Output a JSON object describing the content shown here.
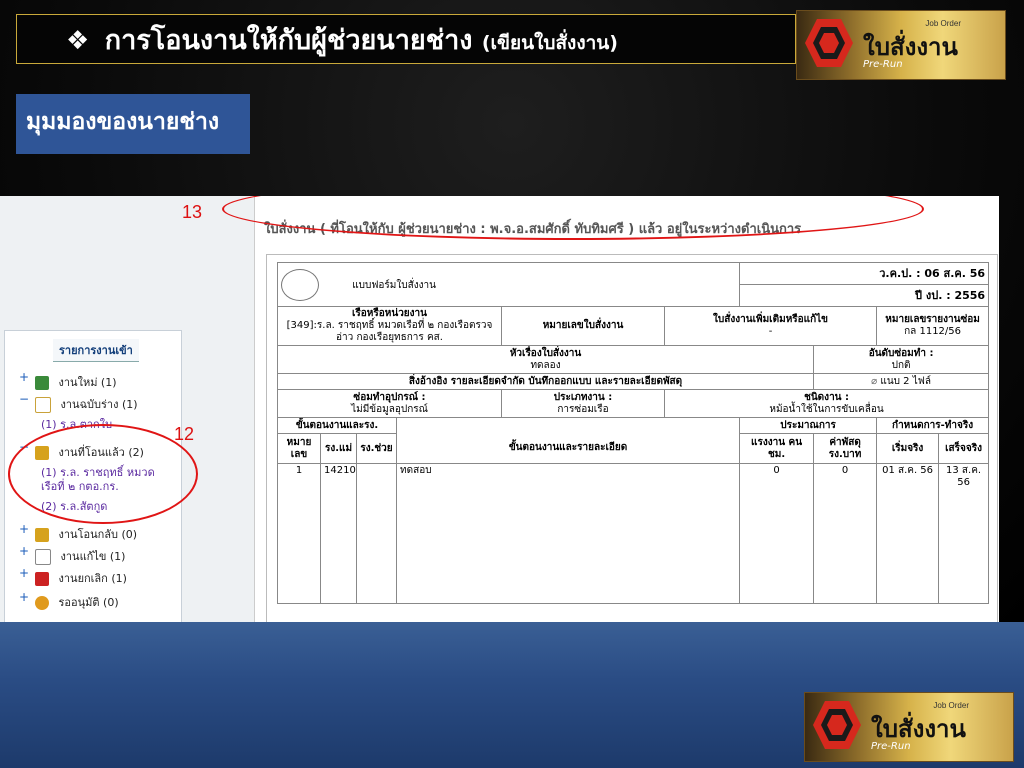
{
  "slide": {
    "bullet": "❖",
    "title_main": "การโอนงานให้กับผู้ช่วยนายช่าง",
    "title_paren": "(เขียนใบสั่งงาน)",
    "view_label": "มุมมองของนายช่าง"
  },
  "logo": {
    "name": "ใบสั่งงาน",
    "job_order": "Job Order",
    "pre_run": "Pre-Run"
  },
  "callouts": {
    "n13": "13",
    "n12": "12"
  },
  "sidebar": {
    "header": "รายการงานเข้า",
    "items": [
      {
        "sign": "+",
        "label": "งานใหม่ (1)",
        "icon_color": "#3a8a3a"
      },
      {
        "sign": "−",
        "label": "งานฉบับร่าง (1)",
        "icon_color": "#c9a23a"
      },
      {
        "sign": "−",
        "label": "งานที่โอนแล้ว (2)",
        "icon_color": "#d6a21d"
      },
      {
        "sign": "+",
        "label": "งานโอนกลับ (0)",
        "icon_color": "#d6a21d"
      },
      {
        "sign": "+",
        "label": "งานแก้ไข (1)",
        "icon_color": "#e0b54a"
      },
      {
        "sign": "+",
        "label": "งานยกเลิก (1)",
        "icon_color": "#c22"
      },
      {
        "sign": "+",
        "label": "รออนุมัติ (0)",
        "icon_color": "#e09a1d"
      }
    ],
    "draft_sub": "(1) ร.ล.ตากใบ",
    "transferred_sub1_a": "(1) ร.ล. ราชฤทธิ์ หมวด",
    "transferred_sub1_b": "เรือที่ ๒ กตอ.กร.",
    "transferred_sub2": "(2) ร.ล.สัตกูด"
  },
  "header_line": "ใบสั่งงาน ( ที่โอนให้กับ ผู้ช่วยนายช่าง : พ.จ.อ.สมศักดิ์  ทับทิมศรี ) แล้ว อยู่ในระหว่างดำเนินการ",
  "form": {
    "form_title": "แบบฟอร์มใบสั่งงาน",
    "vkp_label": "ว.ค.ป. : 06 ส.ค. 56",
    "year_label": "ปี งป. : 2556",
    "ship_label": "เรือหรือหน่วยงาน",
    "ship_value_1": "[349]:ร.ล. ราชฤทธิ์ หมวดเรือที่ ๒ กองเรือตรวจ",
    "ship_value_2": "อ่าว กองเรือยุทธการ       คส.",
    "order_no_label": "หมายเลขใบสั่งงาน",
    "extra_label": "ใบสั่งงานเพิ่มเติมหรือแก้ไข",
    "extra_value": "-",
    "report_label": "หมายเลขรายงานซ่อม",
    "report_value": "กล 1112/56",
    "subject_label": "หัวเรื่องใบสั่งงาน",
    "subject_value": "ทดลอง",
    "priority_label": "อันดับซ่อมทำ :",
    "priority_value": "ปกติ",
    "ref_label": "สิ่งอ้างอิง รายละเอียดจำกัด บันทึกออกแบบ และรายละเอียดพัสดุ",
    "attach_label": "แนบ 2 ไฟล์",
    "equip_label": "ซ่อมทำอุปกรณ์ :",
    "equip_value": "ไม่มีข้อมูลอุปกรณ์",
    "worktype_label": "ประเภทงาน :",
    "worktype_value": "การซ่อมเรือ",
    "kind_label": "ชนิดงาน :",
    "kind_value": "หม้อน้ำใช้ในการขับเคลื่อน",
    "steps_label": "ขั้นตอนงานและรง.",
    "estimate_label": "ประมาณการ",
    "schedule_label": "กำหนดการ-ทำจริง",
    "col_no": "หมาย เลข",
    "col_main": "รง.แม่",
    "col_help": "รง.ช่วย",
    "col_detail": "ขั้นตอนงานและรายละเอียด",
    "col_labor": "แรงงาน คน ชม.",
    "col_cost": "ค่าพัสดุ รง.บาท",
    "col_start": "เริ่มจริง",
    "col_end": "เสร็จจริง",
    "rows": [
      {
        "no": "1",
        "main": "14210",
        "help": "",
        "detail": "ทดสอบ",
        "labor": "0",
        "cost": "0",
        "start": "01 ส.ค. 56",
        "end": "13 ส.ค. 56"
      }
    ]
  }
}
